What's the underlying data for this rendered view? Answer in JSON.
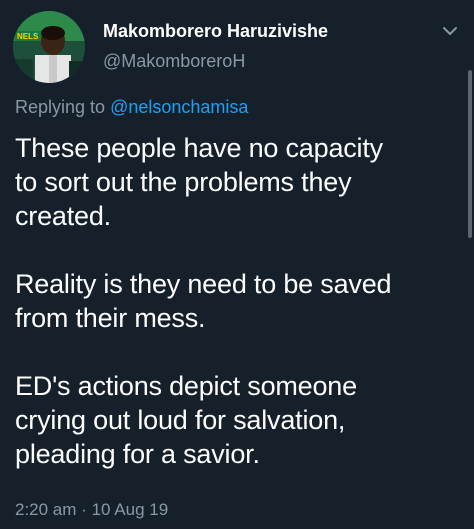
{
  "colors": {
    "background": "#15202B",
    "text_primary": "#FFFFFF",
    "text_secondary": "#8899A6",
    "accent": "#1DA1F2"
  },
  "author": {
    "display_name": "Makomborero Haruzivishe",
    "handle": "@MakomboreroH",
    "avatar_badge_text": "NELS"
  },
  "reply": {
    "prefix": "Replying to",
    "mention": "@nelsonchamisa"
  },
  "tweet": {
    "paragraphs": [
      {
        "lines": [
          "These people have no capacity",
          "to sort out the problems they",
          "created."
        ]
      },
      {
        "lines": [
          "Reality is they need to be saved",
          "from their mess."
        ]
      },
      {
        "lines": [
          "ED's actions depict someone",
          "crying out loud for salvation,",
          "pleading for a savior."
        ]
      }
    ]
  },
  "meta": {
    "time": "2:20 am",
    "separator": "·",
    "date": "10 Aug 19"
  },
  "icons": {
    "menu": "chevron-down-icon"
  }
}
